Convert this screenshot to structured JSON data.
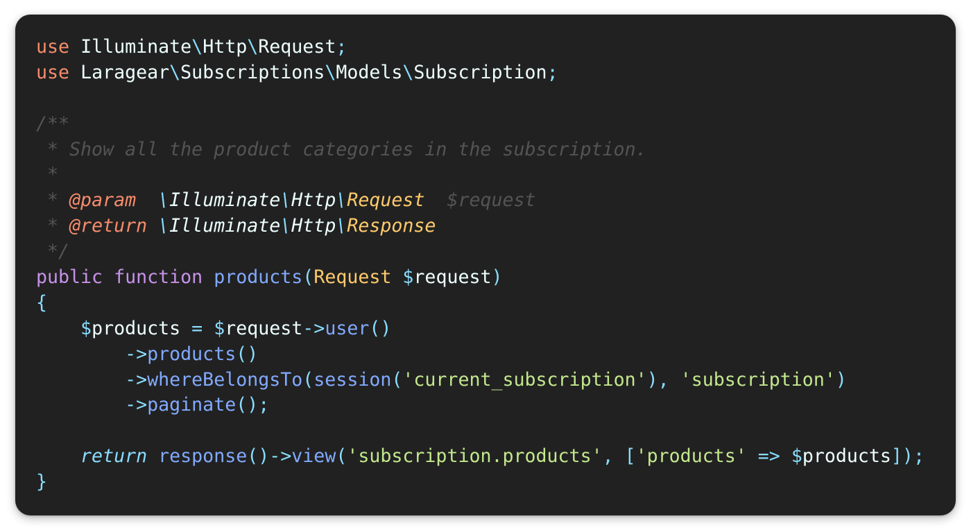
{
  "snippet": {
    "imports": [
      {
        "keyword": "use",
        "parts": [
          "Illuminate",
          "Http",
          "Request"
        ]
      },
      {
        "keyword": "use",
        "parts": [
          "Laragear",
          "Subscriptions",
          "Models",
          "Subscription"
        ]
      }
    ],
    "doc": {
      "open": "/**",
      "description": " * Show all the product categories in the subscription.",
      "blank": " *",
      "param_prefix": " * ",
      "param_tag": "@param",
      "param_ns": [
        "Illuminate",
        "Http"
      ],
      "param_type": "Request",
      "param_var": "$request",
      "return_prefix": " * ",
      "return_tag": "@return",
      "return_ns": [
        "Illuminate",
        "Http"
      ],
      "return_type": "Response",
      "close": " */"
    },
    "signature": {
      "visibility": "public",
      "keyword": "function",
      "name": "products",
      "param_type": "Request",
      "param_var": "$request"
    },
    "body": {
      "var": "$products",
      "receiver": "$request",
      "call_user": "user",
      "call_products": "products",
      "call_where": "whereBelongsTo",
      "call_session": "session",
      "session_key": "'current_subscription'",
      "relation_key": "'subscription'",
      "call_paginate": "paginate",
      "return_keyword": "return",
      "call_response": "response",
      "call_view": "view",
      "view_name": "'subscription.products'",
      "data_key": "'products'",
      "data_var": "$products"
    }
  }
}
